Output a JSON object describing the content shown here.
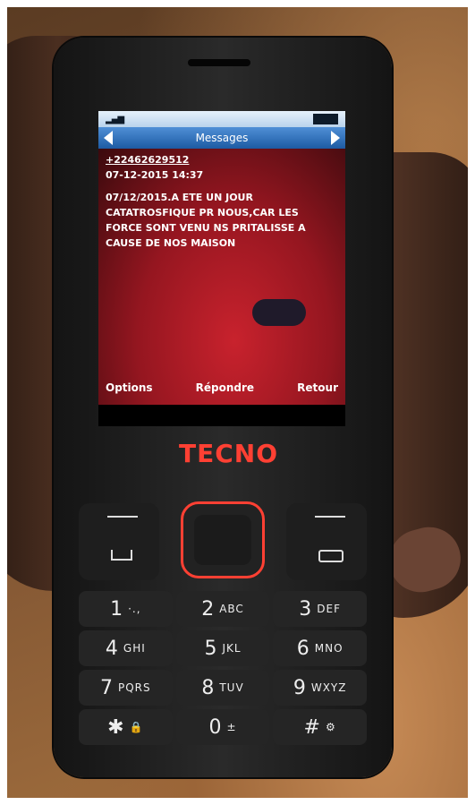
{
  "screen": {
    "status": {
      "signal": "▂▄▆",
      "battery": ""
    },
    "title": "Messages",
    "sender": "+22462629512",
    "datetime": "07-12-2015 14:37",
    "body": "07/12/2015.A ETE UN JOUR CATATROSFIQUE PR NOUS,CAR LES FORCE SONT VENU NS PRITALISSE A CAUSE DE NOS MAISON"
  },
  "softkeys": {
    "left": "Options",
    "center": "Répondre",
    "right": "Retour"
  },
  "brand": "TECNO",
  "keys": [
    {
      "num": "1",
      "letters": "·.,"
    },
    {
      "num": "2",
      "letters": "ABC"
    },
    {
      "num": "3",
      "letters": "DEF"
    },
    {
      "num": "4",
      "letters": "GHI"
    },
    {
      "num": "5",
      "letters": "JKL"
    },
    {
      "num": "6",
      "letters": "MNO"
    },
    {
      "num": "7",
      "letters": "PQRS"
    },
    {
      "num": "8",
      "letters": "TUV"
    },
    {
      "num": "9",
      "letters": "WXYZ"
    },
    {
      "num": "✱",
      "letters": "🔒"
    },
    {
      "num": "0",
      "letters": "±"
    },
    {
      "num": "#",
      "letters": "⚙"
    }
  ],
  "colors": {
    "brand": "#ff4033",
    "title_bar": "#1d5ba3",
    "screen_bg": "#951620"
  }
}
